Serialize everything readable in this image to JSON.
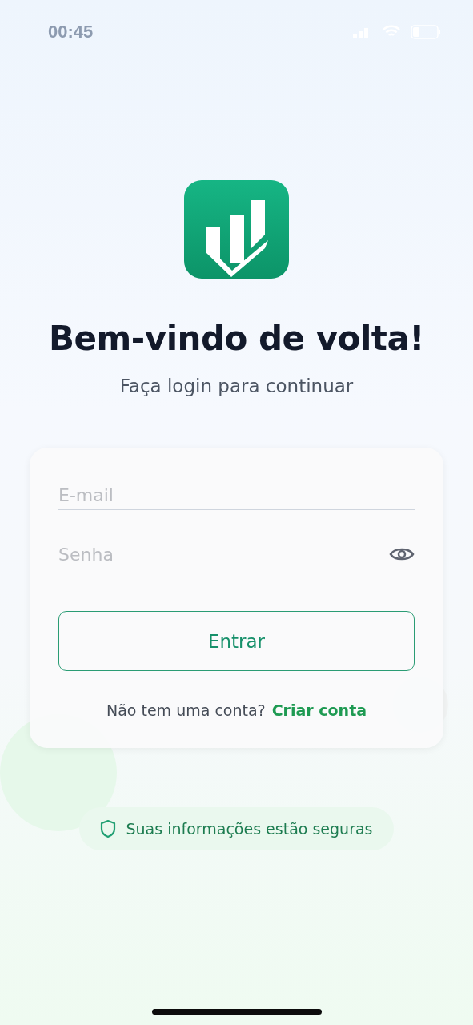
{
  "status_bar": {
    "time": "00:45"
  },
  "title": "Bem-vindo de volta!",
  "subtitle": "Faça login para continuar",
  "form": {
    "email": {
      "placeholder": "E-mail"
    },
    "password": {
      "placeholder": "Senha"
    },
    "submit": "Entrar",
    "signup_prompt": "Não tem uma conta?",
    "signup_link": "Criar conta"
  },
  "security_note": "Suas informações estão seguras"
}
